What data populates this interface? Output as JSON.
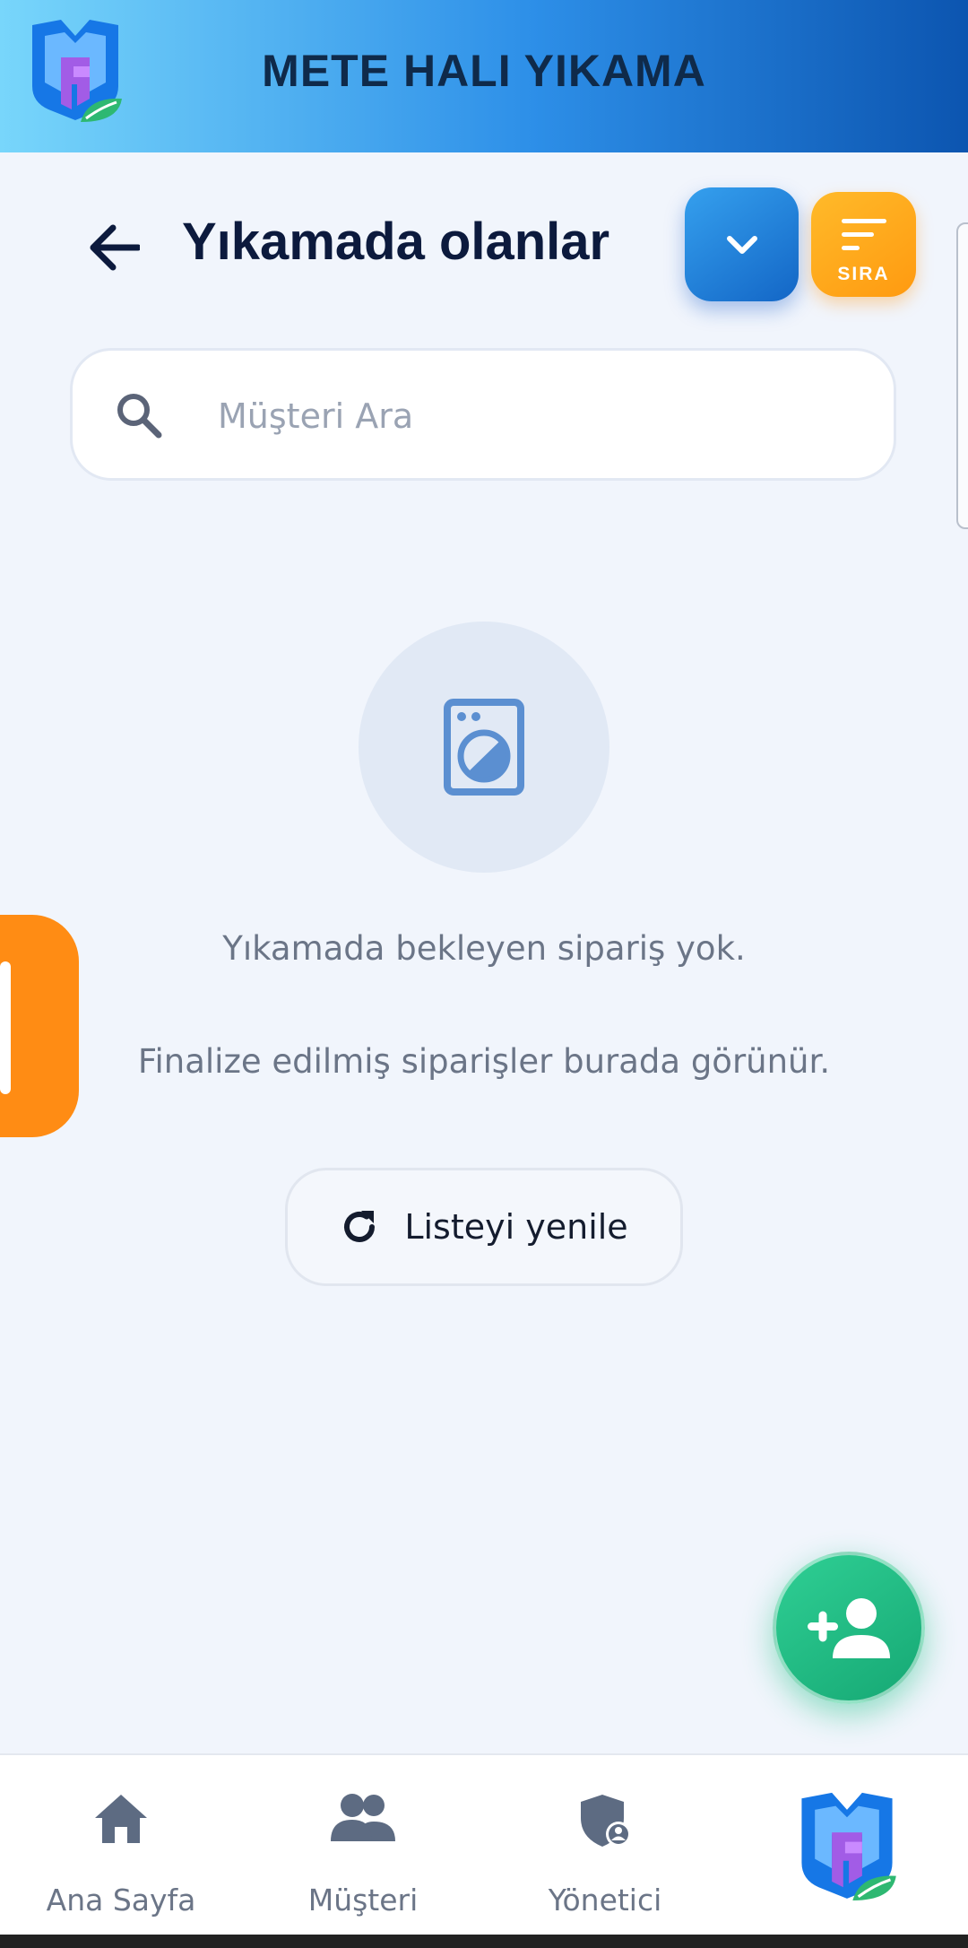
{
  "header": {
    "app_title": "METE HALI YIKAMA"
  },
  "page": {
    "title": "Yıkamada olanlar"
  },
  "toolbar": {
    "sort_label": "SIRA"
  },
  "search": {
    "placeholder": "Müşteri Ara",
    "value": ""
  },
  "empty_state": {
    "title": "Yıkamada bekleyen sipariş yok.",
    "subtitle": "Finalize edilmiş siparişler burada görünür.",
    "refresh_label": "Listeyi yenile"
  },
  "bottom_nav": {
    "items": [
      {
        "label": "Ana Sayfa",
        "icon": "home-icon"
      },
      {
        "label": "Müşteri",
        "icon": "users-icon"
      },
      {
        "label": "Yönetici",
        "icon": "admin-shield-icon"
      },
      {
        "label": "",
        "icon": "app-logo"
      }
    ]
  },
  "colors": {
    "header_gradient_start": "#78d6fb",
    "header_gradient_end": "#0c55b0",
    "dropdown_button": "#1f7fdc",
    "sort_button": "#ffa51a",
    "fab": "#1fbd84",
    "side_tab": "#ff8c14",
    "background": "#f1f5fc"
  }
}
